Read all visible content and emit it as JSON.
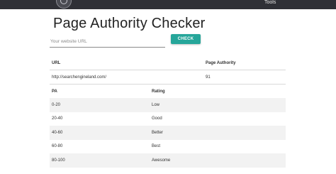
{
  "nav": {
    "tools_label": "Tools"
  },
  "page": {
    "title": "Page Authority Checker"
  },
  "form": {
    "url_placeholder": "Your website URL",
    "check_label": "CHECK"
  },
  "result": {
    "headers": [
      "URL",
      "Page Authority"
    ],
    "rows": [
      [
        "http://searchengineland.com/",
        "91"
      ]
    ]
  },
  "rating": {
    "headers": [
      "PA",
      "Rating"
    ],
    "rows": [
      [
        "0-20",
        "Low"
      ],
      [
        "20-40",
        "Good"
      ],
      [
        "40-60",
        "Better"
      ],
      [
        "60-80",
        "Best"
      ],
      [
        "80-100",
        "Awesome"
      ]
    ]
  },
  "colors": {
    "topbar": "#2f3036",
    "accent": "#26a69a",
    "stripe": "#f2f2f2"
  }
}
